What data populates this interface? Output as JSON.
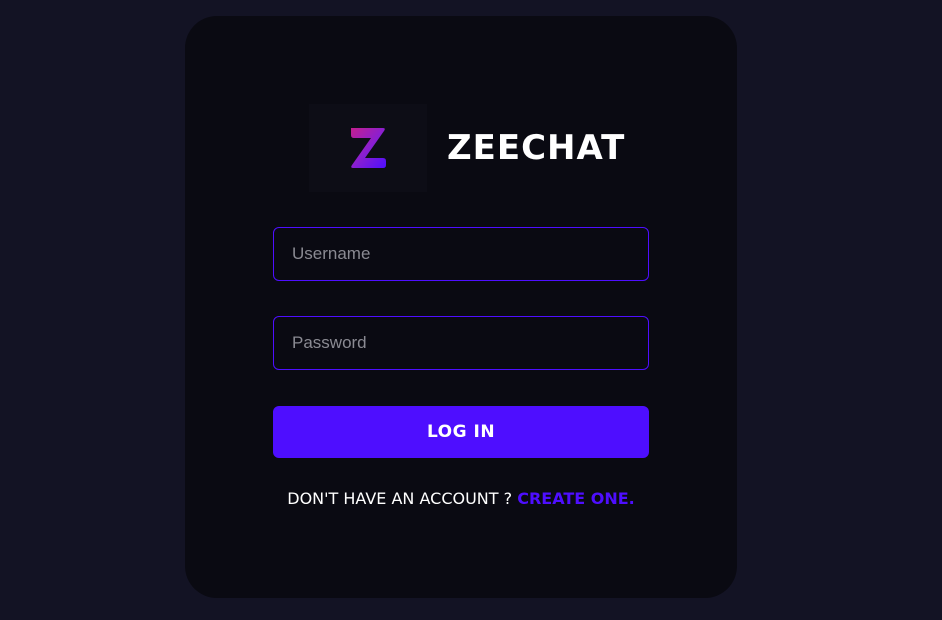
{
  "brand": {
    "title": "ZEECHAT",
    "logo_icon": "z-logo-icon",
    "logo_colors": [
      "#7b2ff7",
      "#c41f8f",
      "#4e0eff"
    ]
  },
  "form": {
    "username_placeholder": "Username",
    "password_placeholder": "Password",
    "username_value": "",
    "password_value": "",
    "login_label": "LOG IN"
  },
  "footer": {
    "prompt": "DON'T HAVE AN ACCOUNT ? ",
    "link_label": "CREATE ONE."
  },
  "colors": {
    "page_bg": "#131324",
    "card_bg": "#0a0a12",
    "accent": "#4e0eff",
    "text": "#ffffff",
    "placeholder": "#8a8a92"
  }
}
